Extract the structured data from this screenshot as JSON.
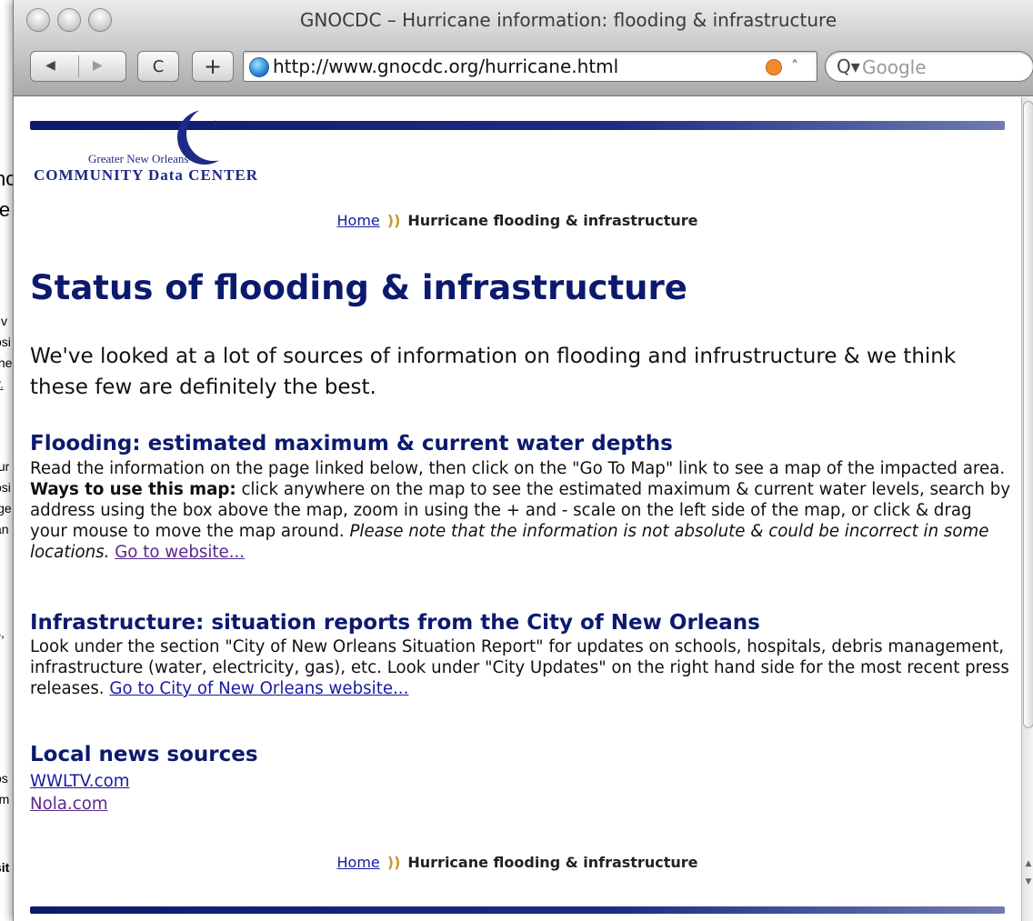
{
  "background_window": {
    "fragments": [
      "nc",
      "ie",
      "tiv",
      "osi",
      "the",
      "y.",
      "tur",
      "osi",
      "ige",
      "an",
      "s,",
      "ti",
      "os",
      "rm",
      "sit"
    ]
  },
  "window": {
    "title": "GNOCDC – Hurricane information: flooding & infrastructure"
  },
  "toolbar": {
    "back_label": "◀",
    "forward_label": "▶",
    "reload_label": "C",
    "add_label": "+",
    "url": "http://www.gnocdc.org/hurricane.html",
    "search_placeholder": "Google",
    "search_icon": "Q▾",
    "snapback_icon": "˄"
  },
  "logo": {
    "top_text": "Greater New Orleans",
    "main_text": "COMMUNITY Data CENTER"
  },
  "breadcrumb": {
    "home_label": "Home",
    "separator": "))",
    "current": "Hurricane flooding & infrastructure"
  },
  "page": {
    "title": "Status of flooding & infrastructure",
    "intro": "We've looked at a lot of sources of information on flooding and infrustructure & we think these few are definitely the best."
  },
  "sections": {
    "flooding": {
      "heading": "Flooding: estimated maximum & current water depths",
      "text_a": "Read the information on the page linked below, then click on the \"Go To Map\" link to see a map of the impacted area. ",
      "text_bold": "Ways to use this map:",
      "text_b": " click anywhere on the map to see the estimated maximum & current water levels, search by address using the box above the map, zoom in using the + and - scale on the left side of the map, or click & drag your mouse to move the map around. ",
      "text_italic": "Please note that the information is not absolute & could be incorrect in some locations.",
      "link_label": "Go to website..."
    },
    "infrastructure": {
      "heading": "Infrastructure: situation reports from the City of New Orleans",
      "text": "Look under the section \"City of New Orleans Situation Report\" for updates on schools, hospitals, debris management, infrastructure (water, electricity, gas), etc. Look under \"City Updates\" on the right hand side for the most recent press releases. ",
      "link_label": "Go to City of New Orleans website..."
    },
    "news": {
      "heading": "Local news sources",
      "links": [
        "WWLTV.com",
        "Nola.com"
      ]
    }
  },
  "colors": {
    "heading_navy": "#0c1a6e",
    "link_blue": "#1a1aa0",
    "visited_purple": "#5a2a8a",
    "breadcrumb_separator": "#c79a2c"
  }
}
